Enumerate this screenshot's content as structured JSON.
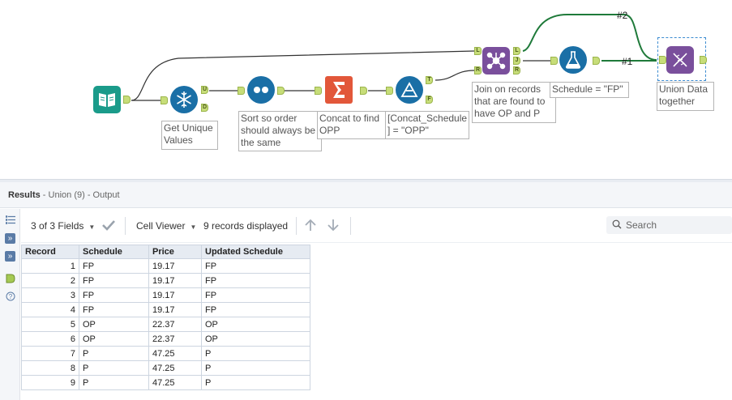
{
  "canvas": {
    "tools": [
      {
        "id": "input",
        "color": "#1a9b8a",
        "icon": "book-icon"
      },
      {
        "id": "unique",
        "color": "#1a6fa6",
        "icon": "snowflake-icon",
        "anchors": [
          "U",
          "D"
        ]
      },
      {
        "id": "sort",
        "color": "#1a6fa6",
        "icon": "dots-icon"
      },
      {
        "id": "summarize",
        "color": "#e2573a",
        "icon": "sigma-icon"
      },
      {
        "id": "filter1",
        "color": "#1a6fa6",
        "icon": "filter-triangle-icon",
        "anchors": [
          "T",
          "F"
        ]
      },
      {
        "id": "join",
        "color": "#7a4f9c",
        "icon": "join-icon",
        "anchors_in": [
          "L",
          "R"
        ],
        "anchors_out": [
          "L",
          "J",
          "R"
        ]
      },
      {
        "id": "formula",
        "color": "#1a6fa6",
        "icon": "flask-icon"
      },
      {
        "id": "union",
        "color": "#7a4f9c",
        "icon": "dna-icon"
      }
    ],
    "annotations": {
      "unique": "Get Unique\nValues",
      "sort": "Sort so order\nshould always be\nthe same",
      "summarize": "Concat to find\nOPP",
      "filter1": "[Concat_Schedule\n] = \"OPP\"",
      "join": "Join on records\nthat are found to\nhave OP and P",
      "formula": "Schedule = \"FP\"",
      "union": "Union Data\ntogether"
    },
    "wire_labels": {
      "top": "#2",
      "bottom": "#1"
    }
  },
  "results": {
    "title": "Results",
    "subtitle": " - Union (9) - Output",
    "toolbar": {
      "fields": "3 of 3 Fields",
      "viewer": "Cell Viewer",
      "records": "9 records displayed",
      "search_placeholder": "Search"
    },
    "columns": [
      "Record",
      "Schedule",
      "Price",
      "Updated Schedule"
    ],
    "rows": [
      [
        "1",
        "FP",
        "19.17",
        "FP"
      ],
      [
        "2",
        "FP",
        "19.17",
        "FP"
      ],
      [
        "3",
        "FP",
        "19.17",
        "FP"
      ],
      [
        "4",
        "FP",
        "19.17",
        "FP"
      ],
      [
        "5",
        "OP",
        "22.37",
        "OP"
      ],
      [
        "6",
        "OP",
        "22.37",
        "OP"
      ],
      [
        "7",
        "P",
        "47.25",
        "P"
      ],
      [
        "8",
        "P",
        "47.25",
        "P"
      ],
      [
        "9",
        "P",
        "47.25",
        "P"
      ]
    ]
  }
}
